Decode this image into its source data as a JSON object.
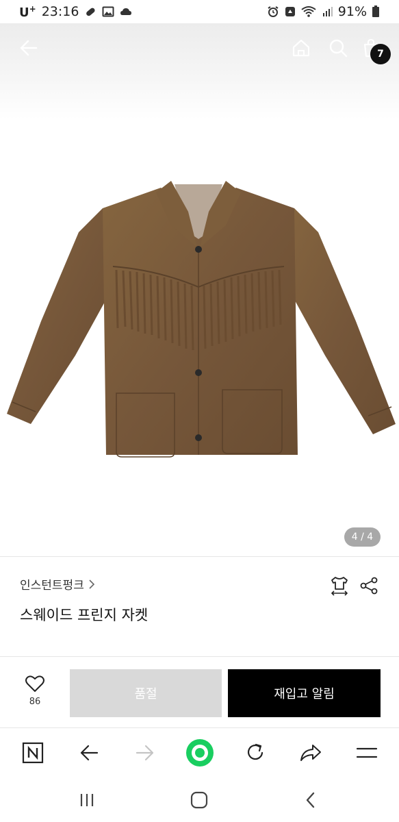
{
  "status_bar": {
    "carrier": "U",
    "carrier_sup": "+",
    "time": "23:16",
    "battery": "91%"
  },
  "hero": {
    "page_indicator": "4 / 4",
    "cart_count": "7"
  },
  "product": {
    "brand": "인스턴트펑크",
    "title": "스웨이드 프린지 자켓"
  },
  "actions": {
    "like_count": "86",
    "soldout_label": "품절",
    "restock_label": "재입고 알림"
  },
  "colors": {
    "accent": "#000000",
    "soldout": "#d9d9d9",
    "browser_green": "#19ce60",
    "suede": "#7a5a3a"
  },
  "icons": [
    "back-arrow-icon",
    "home-icon",
    "search-icon",
    "cart-icon",
    "size-guide-icon",
    "share-icon",
    "heart-icon",
    "naver-icon",
    "reload-icon",
    "menu-icon"
  ]
}
